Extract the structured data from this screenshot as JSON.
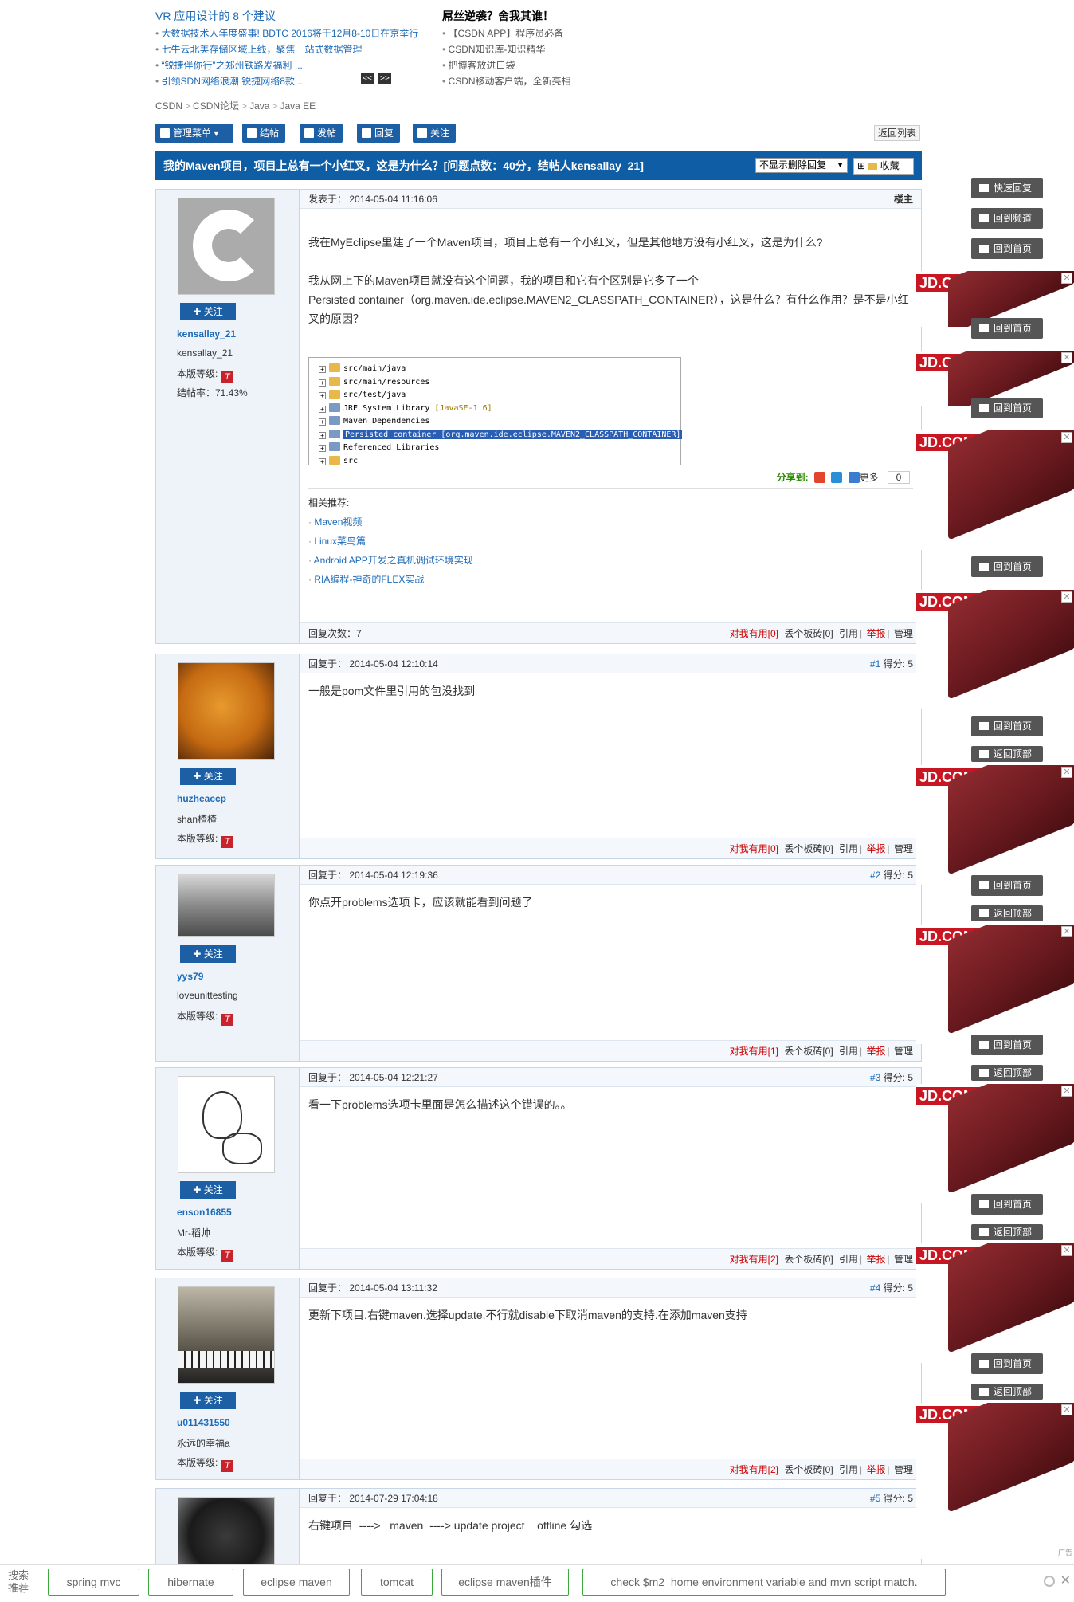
{
  "promo": {
    "left_head": "VR 应用设计的 8 个建议",
    "left_items": [
      "大数据技术人年度盛事! BDTC 2016将于12月8-10日在京举行",
      "七牛云北美存储区域上线，聚焦一站式数据管理",
      "“锐捷伴你行”之郑州铁路发福利 ...",
      "引领SDN网络浪潮 锐捷网络8款..."
    ],
    "pager_prev": "<<",
    "pager_next": ">>",
    "right_head": "屌丝逆袭？舍我其谁！",
    "right_items": [
      "【CSDN APP】程序员必备",
      "CSDN知识库-知识精华",
      "把博客放进口袋",
      "CSDN移动客户端，全新亮相"
    ]
  },
  "breadcrumb": [
    "CSDN",
    "CSDN论坛",
    "Java",
    "Java EE"
  ],
  "toolbar": {
    "manage": "管理菜单",
    "close": "结帖",
    "post": "发帖",
    "reply": "回复",
    "follow": "关注",
    "back_list": "返回列表"
  },
  "topic": {
    "title": "我的Maven项目，项目上总有一个小红叉，这是为什么？[问题点数：40分，结帖人kensallay_21]",
    "filter": "不显示删除回复",
    "favorite": "收藏"
  },
  "common": {
    "follow": "关注",
    "level_label": "本版等级:",
    "useful": "对我有用",
    "brick": "丢个板砖",
    "quote": "引用",
    "report": "举报",
    "manage": "管理",
    "score_label": "得分:"
  },
  "op": {
    "username": "kensallay_21",
    "nickname": "kensallay_21",
    "rate": "结帖率：71.43%",
    "level": "T",
    "label": "发表于：",
    "time": "2014-05-04 11:16:06",
    "floor": "楼主",
    "p1": "我在MyEclipse里建了一个Maven项目，项目上总有一个小红叉，但是其他地方没有小红叉，这是为什么?",
    "p2": "我从网上下的Maven项目就没有这个问题，我的项目和它有个区别是它多了一个",
    "p3": "Persisted container（org.maven.ide.eclipse.MAVEN2_CLASSPATH_CONTAINER），这是什么？有什么作用？是不是小红叉的原因？",
    "tree": [
      "src/main/java",
      "src/main/resources",
      "src/test/java",
      "JRE System Library",
      "Maven Dependencies",
      "Persisted container [org.maven.ide.eclipse.MAVEN2_CLASSPATH_CONTAINER]",
      "Referenced Libraries",
      "src"
    ],
    "tree_jre": "[JavaSE-1.6]",
    "share": "分享到:",
    "more": "更多",
    "share_count": "0",
    "related_title": "相关推荐:",
    "related": [
      "Maven视频",
      "Linux菜鸟篇",
      "Android APP开发之真机调试环境实现",
      "RIA编程-神奇的FLEX实战"
    ],
    "replies": "回复次数：7",
    "useful_count": "[0]",
    "brick_count": "[0]"
  },
  "replies": [
    {
      "username": "huzheaccp",
      "nickname": "shan楂楂",
      "level": "T",
      "time": "2014-05-04 12:10:14",
      "floor": "#1",
      "score": "5",
      "content": "一般是pom文件里引用的包没找到",
      "useful_count": "[0]",
      "brick_count": "[0]"
    },
    {
      "username": "yys79",
      "nickname": "loveunittesting",
      "level": "T",
      "time": "2014-05-04 12:19:36",
      "floor": "#2",
      "score": "5",
      "content": "你点开problems选项卡，应该就能看到问题了",
      "useful_count": "[1]",
      "brick_count": "[0]"
    },
    {
      "username": "enson16855",
      "nickname": "Mr-稻帅",
      "level": "T",
      "time": "2014-05-04 12:21:27",
      "floor": "#3",
      "score": "5",
      "content": "看一下problems选项卡里面是怎么描述这个错误的。。",
      "useful_count": "[2]",
      "brick_count": "[0]"
    },
    {
      "username": "u011431550",
      "nickname": "永远的幸福a",
      "level": "T",
      "time": "2014-05-04 13:11:32",
      "floor": "#4",
      "score": "5",
      "content": "更新下项目.右键maven.选择update.不行就disable下取消maven的支持.在添加maven支持",
      "useful_count": "[2]",
      "brick_count": "[0]"
    },
    {
      "time": "2014-07-29 17:04:18",
      "floor": "#5",
      "score": "5",
      "content": "右键项目  ---->   maven  ----> update project    offline 勾选"
    }
  ],
  "reply_label": "回复于：",
  "side": {
    "quick_reply": "快速回复",
    "back_channel": "回到频道",
    "back_home": "回到首页",
    "back_top": "返回顶部"
  },
  "ad": {
    "brand": "JD.COM 京东",
    "close": "✕",
    "tag": "广告"
  },
  "bottom": {
    "label": "搜索推荐",
    "tags": [
      "spring mvc",
      "hibernate",
      "eclipse maven",
      "tomcat",
      "eclipse maven插件",
      "check $m2_home environment variable and mvn script match."
    ]
  },
  "colors": {
    "accent": "#0f5ea5",
    "button": "#1c5fa5",
    "jd_red": "#c81623",
    "tag_border": "#3ca93c"
  }
}
